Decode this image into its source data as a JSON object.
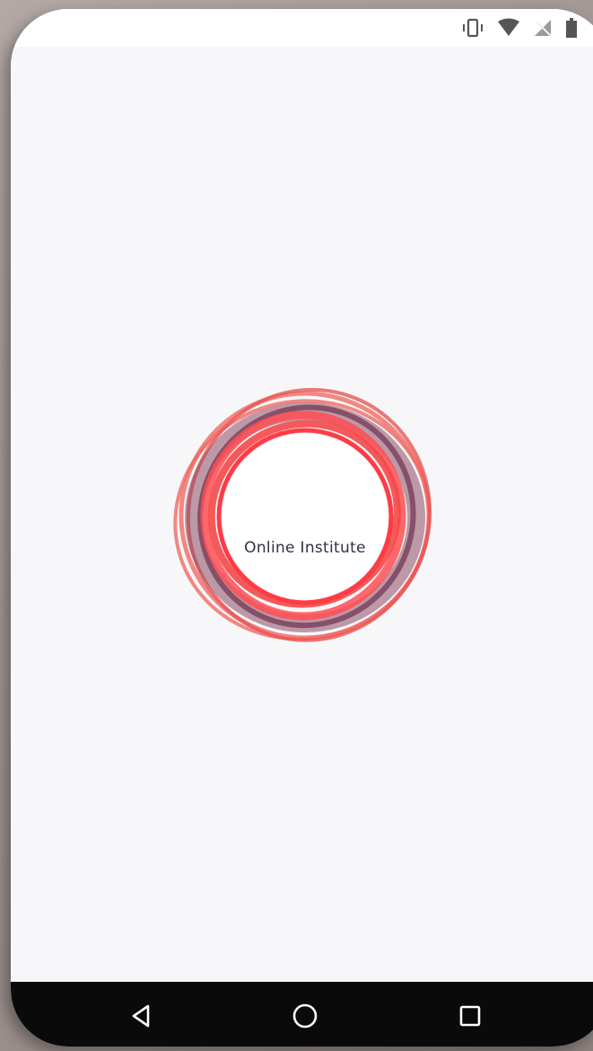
{
  "app": {
    "brand_name": "Online Institute"
  },
  "status_bar": {
    "icons": [
      "vibrate-icon",
      "wifi-icon",
      "no-sim-icon",
      "battery-icon"
    ]
  },
  "navigation": {
    "buttons": [
      "back-icon",
      "home-icon",
      "recents-icon"
    ]
  },
  "colors": {
    "screen_background": "#f7f7f9",
    "logo_ring_primary": "#ee4b4b",
    "logo_ring_dark": "#7a3a52",
    "brand_text": "#2c3340",
    "nav_bar": "#0a0a0a"
  }
}
